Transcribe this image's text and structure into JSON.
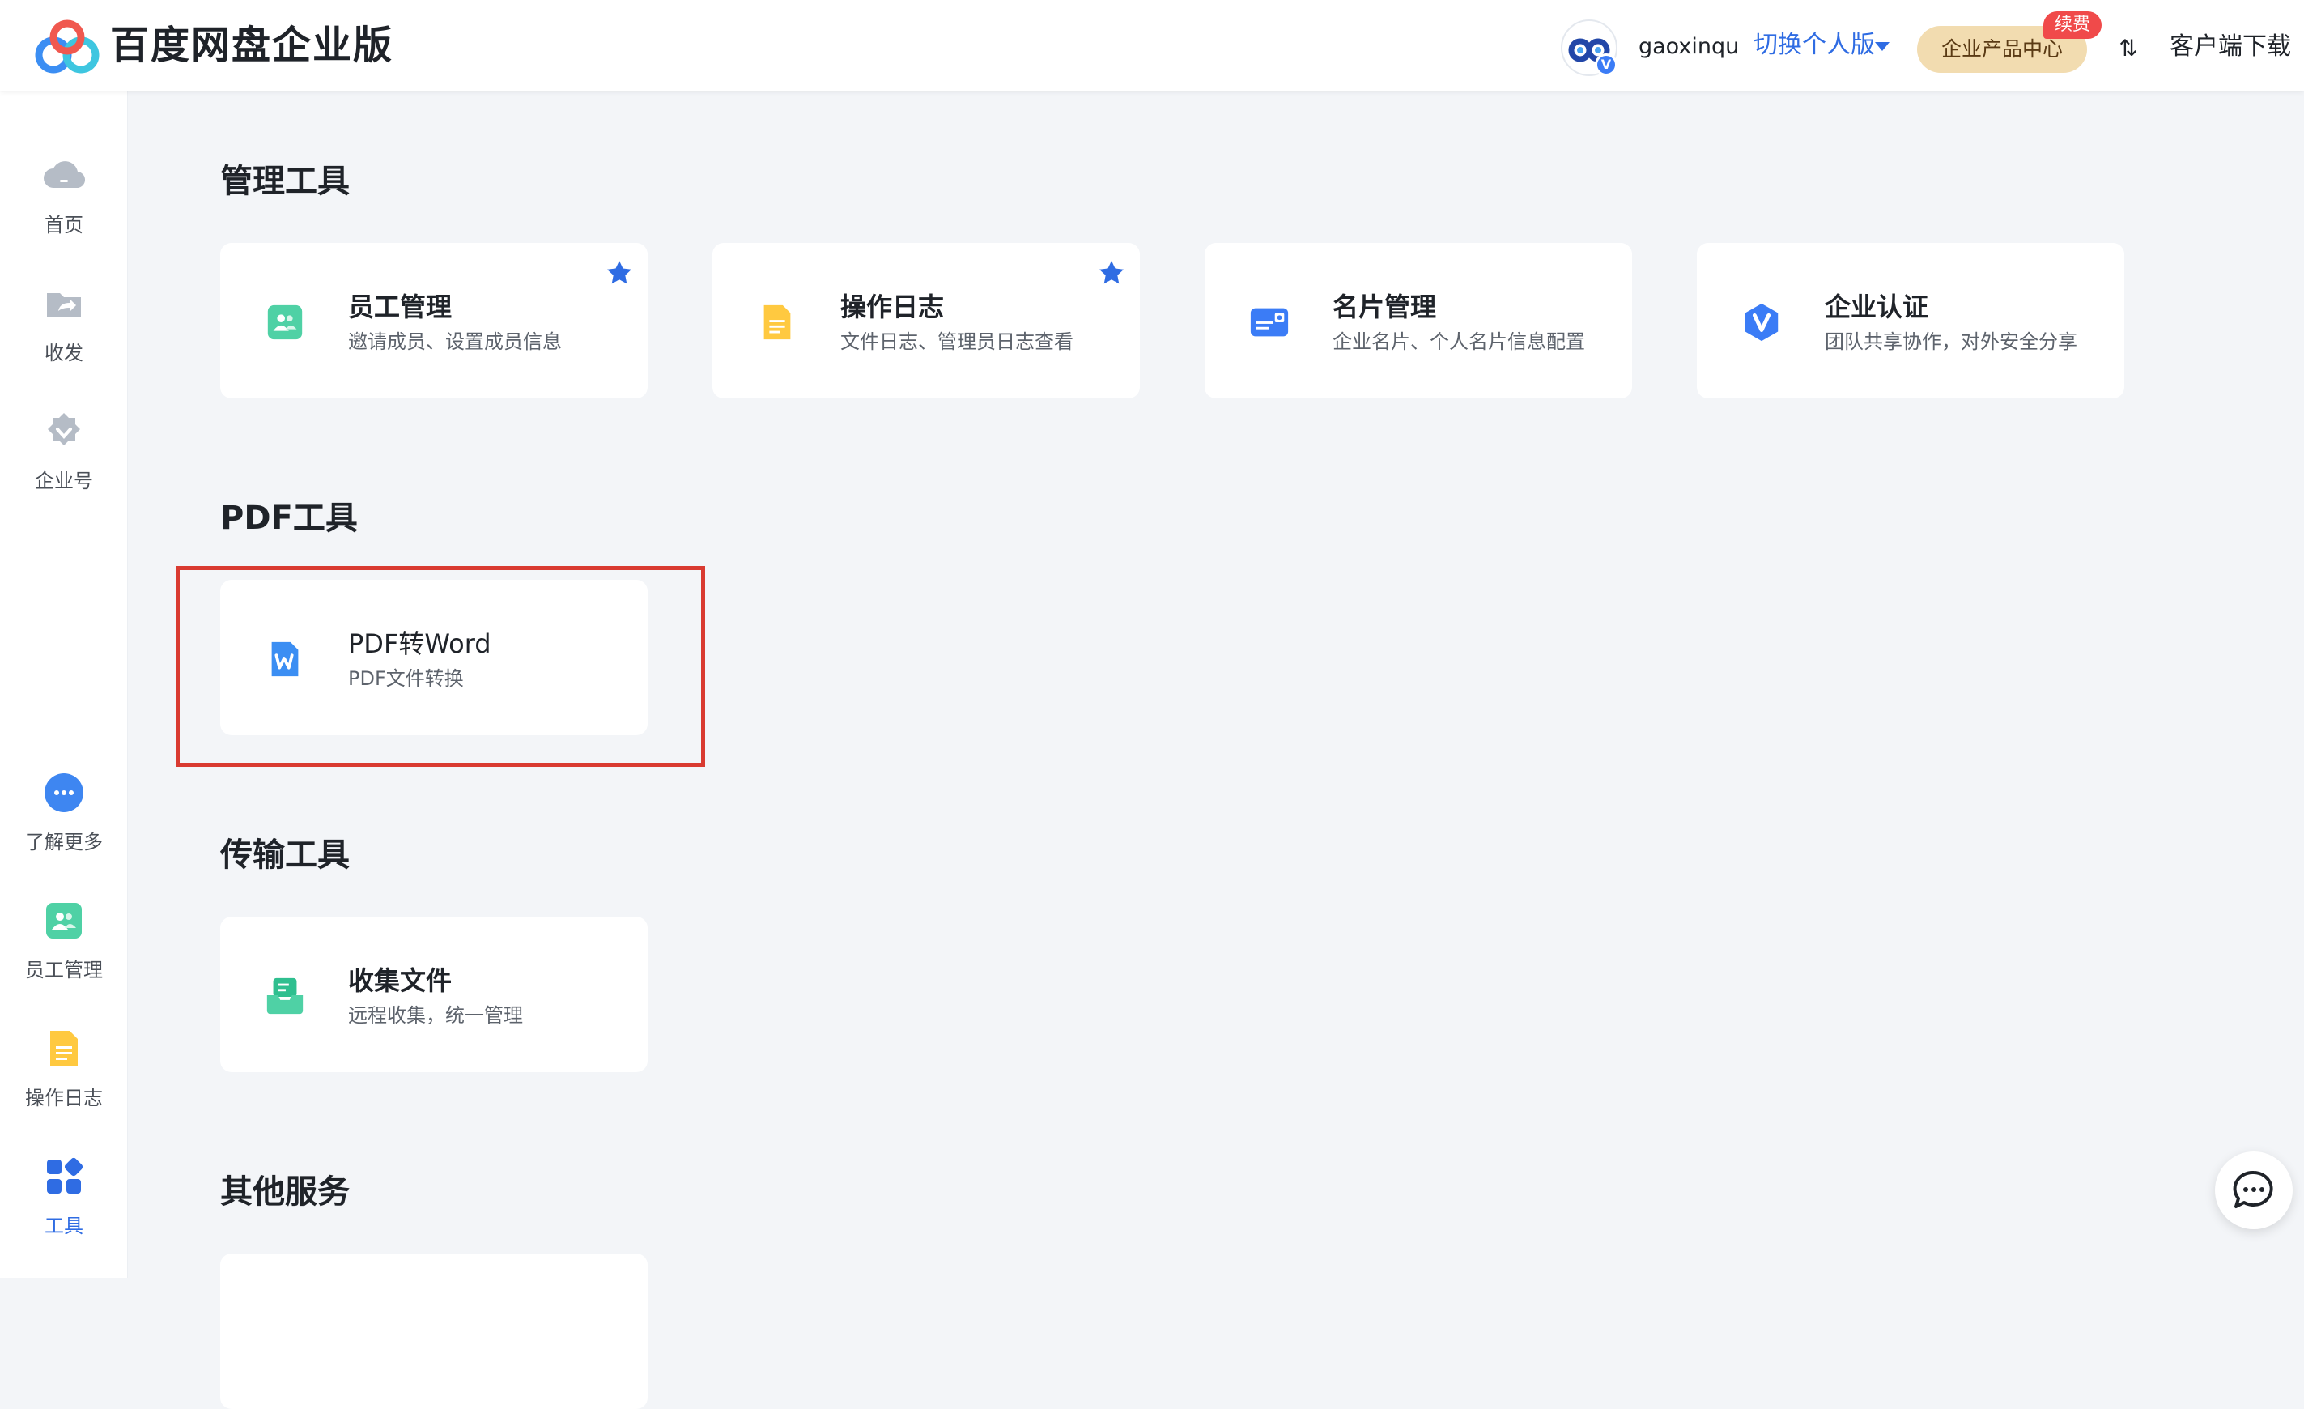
{
  "header": {
    "app_title": "百度网盘企业版",
    "username": "gaoxinqu",
    "avatar_badge": "V",
    "switch_version": "切换个人版",
    "product_center": "企业产品中心",
    "renew_badge": "续费",
    "transfer_icon": "⇅",
    "client_download": "客户端下载"
  },
  "sidebar": {
    "items": [
      {
        "label": "首页",
        "icon": "cloud-icon"
      },
      {
        "label": "收发",
        "icon": "share-folder-icon"
      },
      {
        "label": "企业号",
        "icon": "verified-badge-icon"
      },
      {
        "label": "了解更多",
        "icon": "more-icon"
      },
      {
        "label": "员工管理",
        "icon": "staff-icon"
      },
      {
        "label": "操作日志",
        "icon": "log-icon"
      },
      {
        "label": "工具",
        "icon": "apps-icon",
        "active": true
      }
    ]
  },
  "sections": {
    "management": {
      "title": "管理工具",
      "cards": [
        {
          "title": "员工管理",
          "desc": "邀请成员、设置成员信息",
          "icon": "staff-icon",
          "starred": true
        },
        {
          "title": "操作日志",
          "desc": "文件日志、管理员日志查看",
          "icon": "log-icon",
          "starred": true
        },
        {
          "title": "名片管理",
          "desc": "企业名片、个人名片信息配置",
          "icon": "business-card-icon",
          "starred": false
        },
        {
          "title": "企业认证",
          "desc": "团队共享协作，对外安全分享",
          "icon": "certification-icon",
          "starred": false
        }
      ]
    },
    "pdf": {
      "title": "PDF工具",
      "cards": [
        {
          "title": "PDF转Word",
          "desc": "PDF文件转换",
          "icon": "word-icon",
          "starred": false
        }
      ]
    },
    "transfer": {
      "title": "传输工具",
      "cards": [
        {
          "title": "收集文件",
          "desc": "远程收集，统一管理",
          "icon": "collect-file-icon",
          "starred": false
        }
      ]
    },
    "other": {
      "title": "其他服务"
    }
  },
  "colors": {
    "accent": "#2f6ce3",
    "highlight": "#d93a31",
    "renew": "#f04a4a",
    "product_center_bg": "#f2dcb0"
  }
}
